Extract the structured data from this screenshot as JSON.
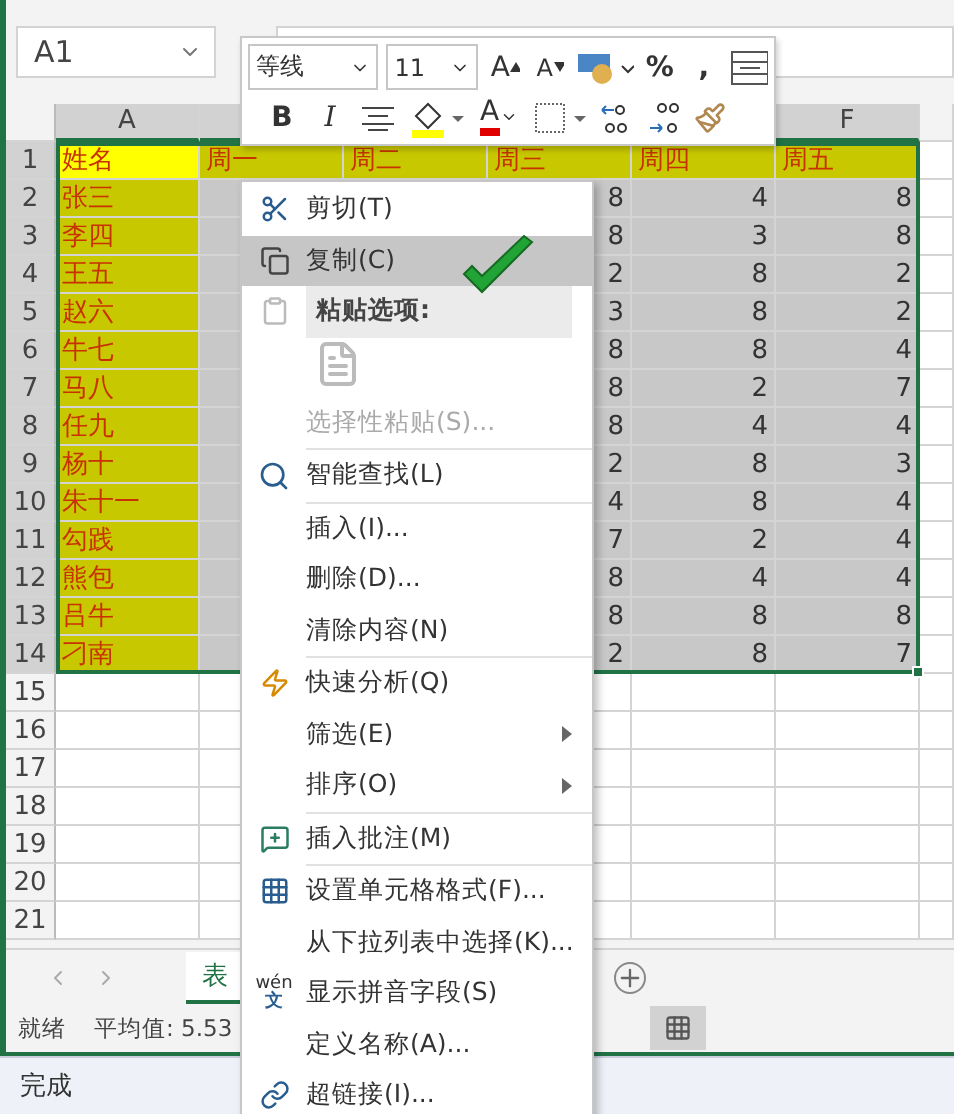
{
  "name_box": {
    "value": "A1"
  },
  "mini_toolbar": {
    "rows": [
      [
        {
          "kind": "dropdown",
          "value": "等线"
        },
        {
          "kind": "dropdown",
          "value": "11"
        },
        {
          "kind": "grow",
          "label": "A"
        },
        {
          "kind": "shrink",
          "label": "A"
        },
        {
          "kind": "currency"
        },
        {
          "kind": "text",
          "label": "%"
        },
        {
          "kind": "text",
          "label": ","
        },
        {
          "kind": "wrap"
        }
      ],
      [
        {
          "kind": "bold",
          "label": "B"
        },
        {
          "kind": "italic",
          "label": "I"
        },
        {
          "kind": "align"
        },
        {
          "kind": "fill"
        },
        {
          "kind": "fontcolor",
          "label": "A"
        },
        {
          "kind": "borders"
        },
        {
          "kind": "decinc"
        },
        {
          "kind": "decdec"
        },
        {
          "kind": "painter"
        }
      ]
    ]
  },
  "column_headers": [
    "A",
    "F"
  ],
  "rows": [
    {
      "number": "1",
      "cells": [
        "姓名",
        "周一",
        "周二",
        "周三",
        "周四",
        "周五"
      ]
    },
    {
      "number": "2",
      "cells": [
        "张三",
        null,
        null,
        "8",
        "4",
        "8"
      ]
    },
    {
      "number": "3",
      "cells": [
        "李四",
        null,
        null,
        "8",
        "3",
        "8"
      ]
    },
    {
      "number": "4",
      "cells": [
        "王五",
        null,
        null,
        "2",
        "8",
        "2"
      ]
    },
    {
      "number": "5",
      "cells": [
        "赵六",
        null,
        null,
        "3",
        "8",
        "2"
      ]
    },
    {
      "number": "6",
      "cells": [
        "牛七",
        null,
        null,
        "8",
        "8",
        "4"
      ]
    },
    {
      "number": "7",
      "cells": [
        "马八",
        null,
        null,
        "8",
        "2",
        "7"
      ]
    },
    {
      "number": "8",
      "cells": [
        "任九",
        null,
        null,
        "8",
        "4",
        "4"
      ]
    },
    {
      "number": "9",
      "cells": [
        "杨十",
        null,
        null,
        "2",
        "8",
        "3"
      ]
    },
    {
      "number": "10",
      "cells": [
        "朱十一",
        null,
        null,
        "4",
        "8",
        "4"
      ]
    },
    {
      "number": "11",
      "cells": [
        "勾践",
        null,
        null,
        "7",
        "2",
        "4"
      ]
    },
    {
      "number": "12",
      "cells": [
        "熊包",
        null,
        null,
        "8",
        "4",
        "4"
      ]
    },
    {
      "number": "13",
      "cells": [
        "吕牛",
        null,
        null,
        "8",
        "8",
        "8"
      ]
    },
    {
      "number": "14",
      "cells": [
        "刁南",
        null,
        null,
        "2",
        "8",
        "7"
      ]
    },
    {
      "number": "15"
    },
    {
      "number": "16"
    },
    {
      "number": "17"
    },
    {
      "number": "18"
    },
    {
      "number": "19"
    },
    {
      "number": "20"
    },
    {
      "number": "21"
    }
  ],
  "sheet_tabs": [
    {
      "label": "表",
      "selected": true
    }
  ],
  "status_bar": {
    "state": "就绪",
    "average": "平均值: 5.53"
  },
  "context_menu": [
    {
      "kind": "item",
      "label": "剪切(T)",
      "selected": false,
      "disabled": false,
      "submenu": false
    },
    {
      "kind": "item",
      "label": "复制(C)",
      "selected": true,
      "disabled": false,
      "submenu": false
    },
    {
      "kind": "header",
      "label": "粘贴选项:"
    },
    {
      "kind": "paste-options"
    },
    {
      "kind": "item",
      "label": "选择性粘贴(S)...",
      "selected": false,
      "disabled": true,
      "submenu": false
    },
    {
      "kind": "separator"
    },
    {
      "kind": "item",
      "label": "智能查找(L)",
      "selected": false,
      "disabled": false,
      "submenu": false
    },
    {
      "kind": "separator"
    },
    {
      "kind": "item",
      "label": "插入(I)...",
      "selected": false,
      "disabled": false,
      "submenu": false
    },
    {
      "kind": "item",
      "label": "删除(D)...",
      "selected": false,
      "disabled": false,
      "submenu": false
    },
    {
      "kind": "item",
      "label": "清除内容(N)",
      "selected": false,
      "disabled": false,
      "submenu": false
    },
    {
      "kind": "separator"
    },
    {
      "kind": "item",
      "label": "快速分析(Q)",
      "selected": false,
      "disabled": false,
      "submenu": false
    },
    {
      "kind": "item",
      "label": "筛选(E)",
      "selected": false,
      "disabled": false,
      "submenu": true
    },
    {
      "kind": "item",
      "label": "排序(O)",
      "selected": false,
      "disabled": false,
      "submenu": true
    },
    {
      "kind": "separator"
    },
    {
      "kind": "item",
      "label": "插入批注(M)",
      "selected": false,
      "disabled": false,
      "submenu": false
    },
    {
      "kind": "separator"
    },
    {
      "kind": "item",
      "label": "设置单元格格式(F)...",
      "selected": false,
      "disabled": false,
      "submenu": false
    },
    {
      "kind": "item",
      "label": "从下拉列表中选择(K)...",
      "selected": false,
      "disabled": false,
      "submenu": false
    },
    {
      "kind": "item",
      "icon_text": [
        "wén",
        "文"
      ],
      "label": "显示拼音字段(S)",
      "selected": false,
      "disabled": false,
      "submenu": false
    },
    {
      "kind": "item",
      "label": "定义名称(A)...",
      "selected": false,
      "disabled": false,
      "submenu": false
    },
    {
      "kind": "item",
      "label": "超链接(I)...",
      "selected": false,
      "disabled": false,
      "submenu": false
    }
  ],
  "browser_status": "完成"
}
